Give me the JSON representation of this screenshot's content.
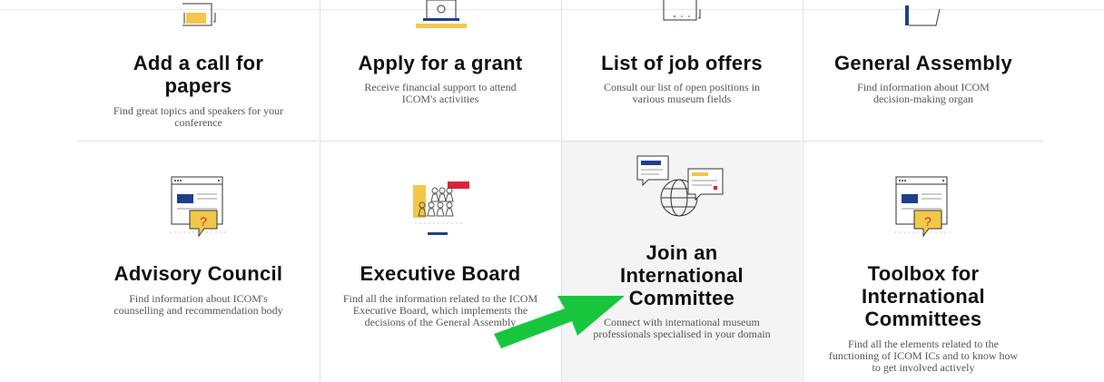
{
  "cards_row1": [
    {
      "title": "Add a call for papers",
      "desc": "Find great topics and speakers for your conference",
      "icon": "document-icon"
    },
    {
      "title": "Apply for a grant",
      "desc": "Receive financial support to attend ICOM's activities",
      "icon": "laptop-icon"
    },
    {
      "title": "List of job offers",
      "desc": "Consult our list of open positions in various museum fields",
      "icon": "calendar-icon"
    },
    {
      "title": "General Assembly",
      "desc": "Find information about ICOM decision-making organ",
      "icon": "book-icon"
    }
  ],
  "cards_row2": [
    {
      "title": "Advisory Council",
      "desc": "Find information about ICOM's counselling and recommendation body",
      "icon": "browser-question-icon"
    },
    {
      "title": "Executive Board",
      "desc": "Find all the information related to the ICOM Executive Board, which implements the decisions of the General Assembly",
      "icon": "group-people-icon"
    },
    {
      "title": "Join an International Committee",
      "desc": "Connect with international museum professionals specialised in your domain",
      "icon": "globe-chat-icon"
    },
    {
      "title": "Toolbox for International Committees",
      "desc": "Find all the elements related to the functioning of ICOM ICs and to know how to get involved actively",
      "icon": "browser-question-icon"
    }
  ],
  "colors": {
    "accent_yellow": "#f2c74a",
    "accent_blue": "#1f3f8c",
    "accent_red": "#d9253b",
    "arrow_green": "#18c63e"
  },
  "overlay": {
    "icon": "green-arrow-icon"
  }
}
